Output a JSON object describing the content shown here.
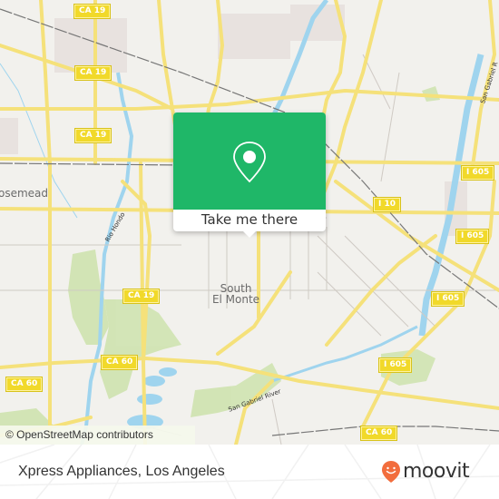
{
  "map": {
    "attribution": "© OpenStreetMap contributors",
    "place_labels": {
      "rosemead": "osemead",
      "south_el_monte_line1": "South",
      "south_el_monte_line2": "El Monte"
    },
    "road_shields": {
      "ca19_a": "CA 19",
      "ca19_b": "CA 19",
      "ca19_c": "CA 19",
      "ca19_d": "CA 19",
      "ca60_a": "CA 60",
      "ca60_b": "CA 60",
      "ca60_c": "CA 60",
      "i10": "I 10",
      "i605_a": "I 605",
      "i605_b": "I 605",
      "i605_c": "I 605",
      "i605_d": "I 605"
    },
    "river_labels": {
      "rio_hondo": "Rio Hondo",
      "san_gabriel_south": "San Gabriel River",
      "san_gabriel_north": "San Gabriel R"
    }
  },
  "popup": {
    "icon": "map-pin-icon",
    "button_label": "Take me there",
    "accent_color": "#1fb768"
  },
  "footer": {
    "title": "Xpress Appliances, Los Angeles",
    "brand": "moovit",
    "brand_color": "#f26d3d"
  }
}
